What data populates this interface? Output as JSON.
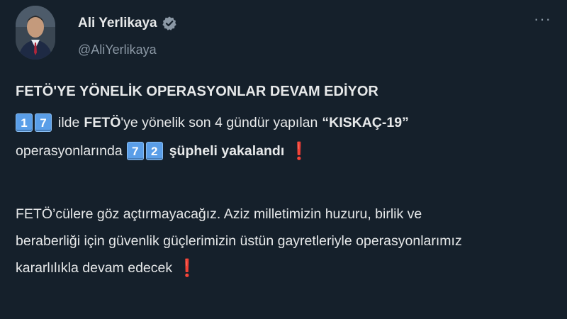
{
  "author": {
    "display_name": "Ali Yerlikaya",
    "handle": "@AliYerlikaya"
  },
  "more_menu_label": "···",
  "headline": "FETÖ'YE YÖNELİK OPERASYONLAR DEVAM EDİYOR",
  "line1": {
    "digits": [
      "1",
      "7"
    ],
    "pre": "ilde",
    "bold1": "FETÖ",
    "mid": "'ye yönelik son 4 gündür yapılan",
    "bold2": "“KISKAÇ-19”"
  },
  "line2": {
    "pre": "operasyonlarında",
    "digits": [
      "7",
      "2"
    ],
    "bold": "şüpheli yakalandı",
    "mark": "❗"
  },
  "paragraph": [
    "FETÖ’cülere göz açtırmayacağız. Aziz milletimizin huzuru, birlik ve",
    "beraberliği için güvenlik güçlerimizin üstün gayretleriyle operasyonlarımız",
    "kararlılıkla devam edecek"
  ],
  "paragraph_mark": "❗",
  "colors": {
    "background": "#15202b",
    "text": "#e7e9ea",
    "muted": "#8b98a5",
    "verified": "#8b98a5",
    "keycap": "#5a9ee8",
    "exclaim": "#e0243c"
  }
}
